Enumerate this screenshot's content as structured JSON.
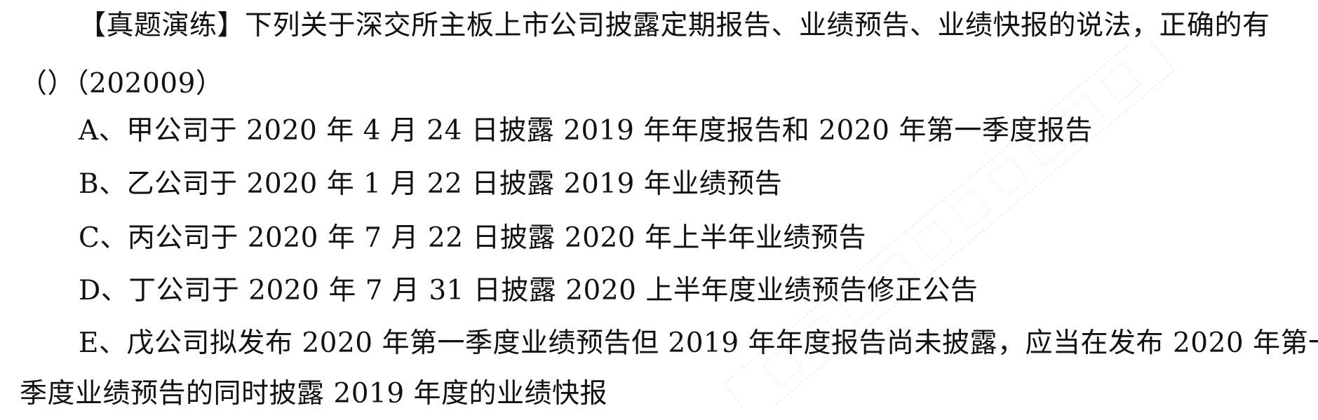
{
  "question": {
    "stem_line1": "【真题演练】下列关于深交所主板上市公司披露定期报告、业绩预告、业绩快报的说法，正确的有",
    "stem_line2": "（）（202009）",
    "options": [
      "A、甲公司于 2020 年 4 月 24 日披露 2019 年年度报告和 2020 年第一季度报告",
      "B、乙公司于 2020 年 1 月 22 日披露 2019 年业绩预告",
      "C、丙公司于 2020 年 7 月 22 日披露 2020 年上半年业绩预告",
      "D、丁公司于 2020 年 7 月 31 日披露 2020 上半年度业绩预告修正公告",
      "E、戊公司拟发布 2020 年第一季度业绩预告但 2019 年年度报告尚未披露，应当在发布 2020 年第一",
      "季度业绩预告的同时披露 2019 年度的业绩快报"
    ]
  }
}
